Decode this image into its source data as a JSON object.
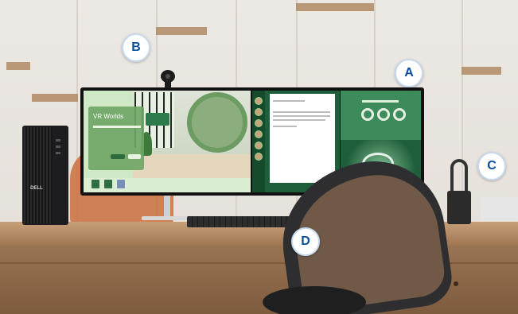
{
  "callouts": {
    "a": "A",
    "b": "B",
    "c": "C",
    "d": "D"
  },
  "monitor": {
    "left_app_title": "VR Worlds"
  },
  "pc": {
    "brand": "DELL"
  },
  "colors": {
    "callout_text": "#0a4f9e",
    "callout_border": "#c7d9ee",
    "screen_green": "#2f7a4c"
  }
}
